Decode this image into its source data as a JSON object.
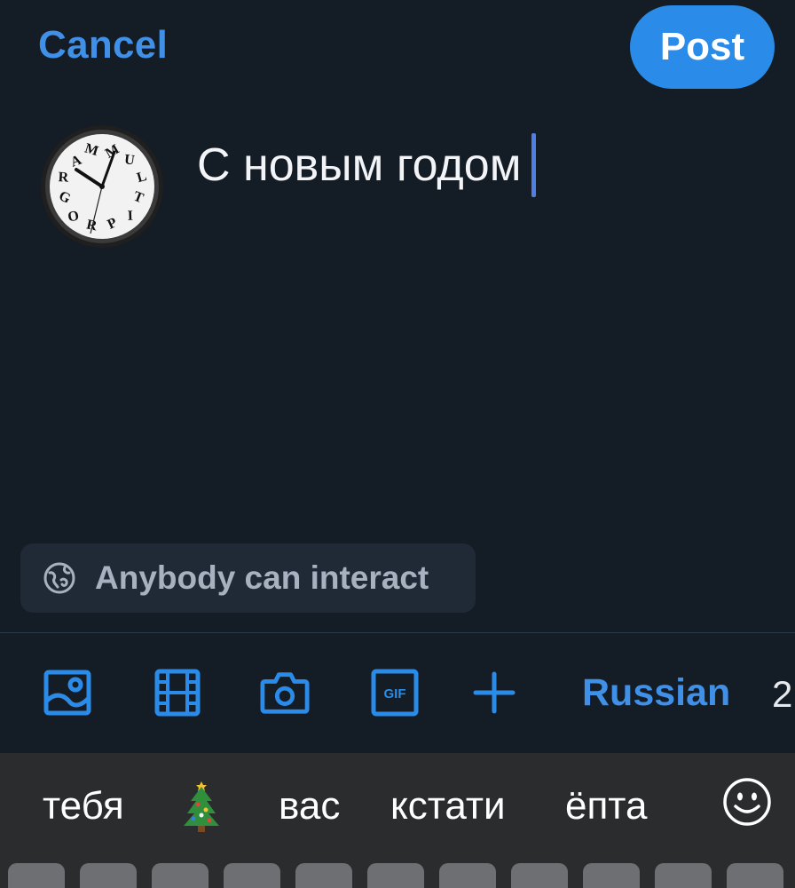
{
  "header": {
    "cancel_label": "Cancel",
    "post_label": "Post"
  },
  "avatar": {
    "clock_letters": [
      "M",
      "U",
      "L",
      "T",
      "I",
      "P",
      "R",
      "O",
      "G",
      "R",
      "A",
      "M"
    ]
  },
  "composer": {
    "text": "С новым годом"
  },
  "interaction": {
    "label": "Anybody can interact",
    "icon": "globe-icon"
  },
  "toolbar": {
    "icons": [
      "image-icon",
      "video-icon",
      "camera-icon",
      "gif-icon",
      "plus-icon"
    ],
    "gif_label": "GIF",
    "language": "Russian",
    "char_count": "2"
  },
  "keyboard": {
    "suggestions": [
      "тебя",
      "вас",
      "кстати",
      "ёпта"
    ],
    "emoji_suggestion": "christmas-tree-icon",
    "emoji_button": "smiley-icon"
  },
  "colors": {
    "background": "#141c26",
    "accent": "#2b8be8",
    "link": "#3f90e6",
    "pill": "#202a36",
    "keyboard": "#2b2c2e"
  }
}
